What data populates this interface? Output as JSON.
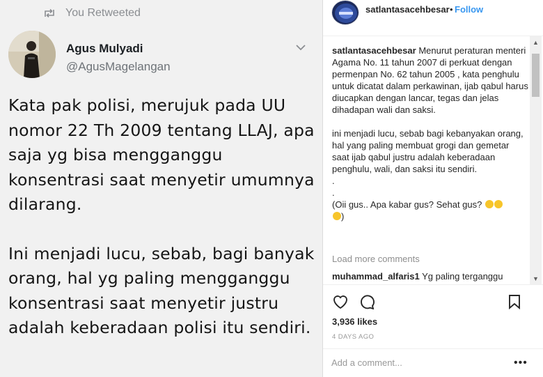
{
  "tweet": {
    "retweet_label": "You Retweeted",
    "name": "Agus Mulyadi",
    "handle": "@AgusMagelangan",
    "paragraphs": [
      "Kata pak polisi, merujuk pada UU nomor 22 Th 2009 tentang LLAJ, apa saja yg bisa mengganggu konsentrasi saat menyetir umumnya dilarang.",
      "Ini menjadi lucu, sebab, bagi banyak orang, hal yg paling mengganggu konsentrasi saat menyetir justru adalah keberadaan polisi itu sendiri."
    ],
    "icons": [
      "retweet-icon",
      "chevron-down-icon"
    ]
  },
  "post": {
    "username": "satlantasacehbesar",
    "separator": "•",
    "follow_label": "Follow",
    "caption": {
      "username": "satlantasacehbesar",
      "part1": "Menurut peraturan menteri Agama No. 11 tahun 2007 di perkuat dengan permenpan No. 62 tahun 2005 , kata penghulu untuk dicatat dalam perkawinan, ijab qabul harus diucapkan dengan lancar, tegas dan jelas dihadapan wali dan saksi.",
      "part2": "ini menjadi lucu, sebab bagi kebanyakan orang, hal yang paling membuat grogi dan gemetar saat ijab qabul justru adalah keberadaan penghulu, wali, dan saksi itu sendiri.",
      "dot1": ".",
      "dot2": ".",
      "part3": "(Oii gus.. Apa kabar gus? Sehat gus?",
      "part3_end": ")"
    },
    "load_more": "Load more comments",
    "first_comment": {
      "username": "muhammad_alfaris1",
      "text": "Yg paling terganggu"
    },
    "likes": "3,936 likes",
    "time_ago": "4 DAYS AGO",
    "comment_placeholder": "Add a comment...",
    "more_label": "•••",
    "icons": [
      "heart-icon",
      "comment-icon",
      "bookmark-icon",
      "more-options-icon"
    ],
    "colors": {
      "accent": "#3897f0",
      "text": "#262626",
      "muted": "#999999"
    }
  }
}
